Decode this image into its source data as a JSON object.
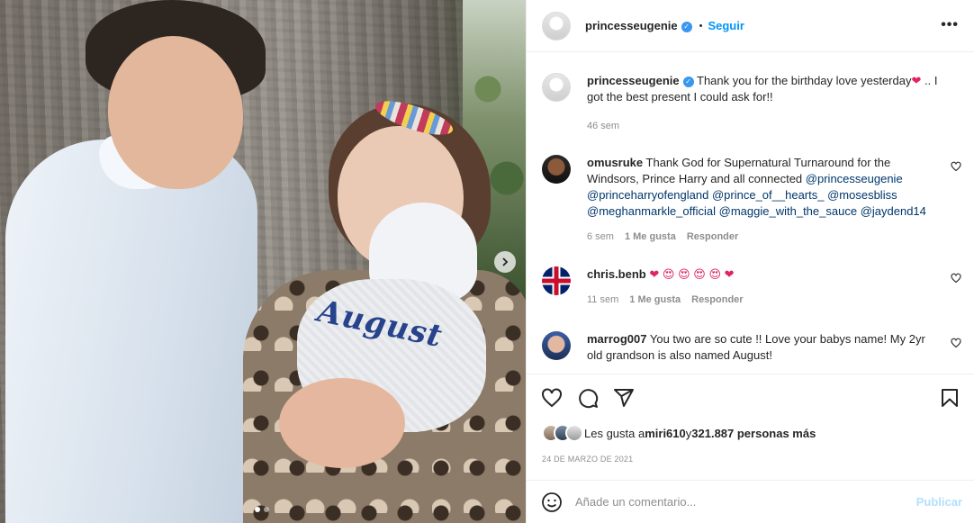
{
  "post": {
    "author": "princesseugenie",
    "follow_label": "Seguir",
    "separator": "•",
    "more_label": "•••",
    "photo_text": "August",
    "caption": {
      "user": "princesseugenie",
      "text_before_emoji": "Thank you for the birthday love yesterday",
      "emoji": "❤",
      "text_after_emoji": " .. I got the best present I could ask for!!",
      "time": "46 sem"
    }
  },
  "comments": [
    {
      "user": "omusruke",
      "text": "Thank God for Supernatural Turnaround for the Windsors, Prince Harry and all connected",
      "mentions": [
        "@princesseugenie",
        "@princeharryofengland",
        "@prince_of__hearts_",
        "@mosesbliss",
        "@meghanmarkle_official",
        "@maggie_with_the_sauce",
        "@jaydend14"
      ],
      "time": "6 sem",
      "likes": "1 Me gusta",
      "reply": "Responder"
    },
    {
      "user": "chris.benb",
      "emojis": [
        "❤",
        "😍",
        "😍",
        "😍",
        "😍",
        "❤"
      ],
      "time": "11 sem",
      "likes": "1 Me gusta",
      "reply": "Responder"
    },
    {
      "user": "marrog007",
      "text": "You two are so cute !! Love your babys name! My 2yr old grandson is also named August!"
    }
  ],
  "likes_summary": {
    "prefix": "Les gusta a ",
    "user": "miri610",
    "middle": " y ",
    "count": "321.887 personas más"
  },
  "date": "24 DE MARZO DE 2021",
  "add_comment": {
    "placeholder": "Añade un comentario...",
    "publish_label": "Publicar"
  },
  "icons": [
    "verified-icon",
    "heart-icon",
    "comment-icon",
    "share-icon",
    "save-icon",
    "emoji-icon",
    "chevron-right-icon",
    "more-icon"
  ],
  "colors": {
    "accent": "#0095f6",
    "publish_disabled": "#b2dffc",
    "muted": "#8e8e8e",
    "mention": "#00376b",
    "verified": "#3897f0"
  }
}
